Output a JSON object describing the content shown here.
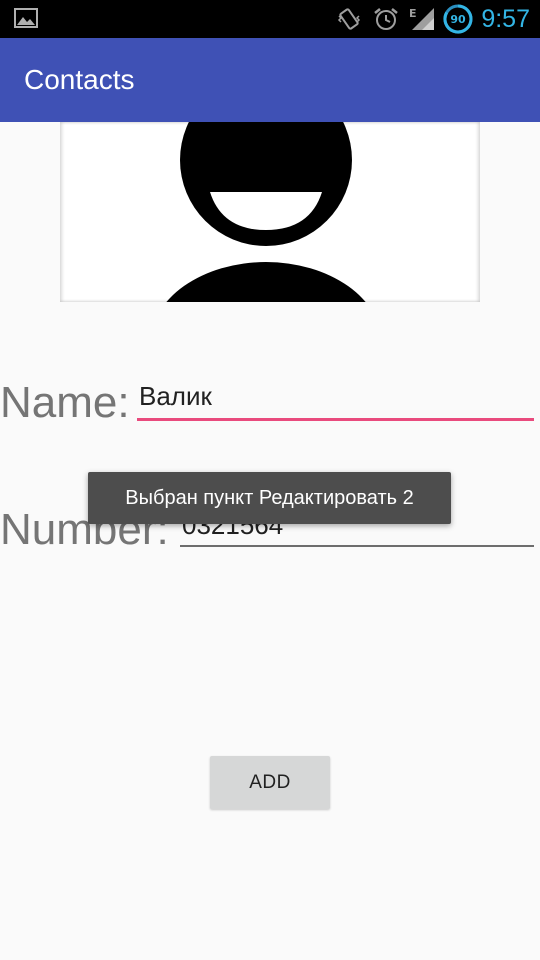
{
  "status_bar": {
    "time": "9:57",
    "battery_level": "90",
    "network_type": "E",
    "icons": [
      "gallery-icon",
      "vibrate-icon",
      "alarm-icon",
      "signal-icon",
      "battery-icon"
    ],
    "time_color": "#33b5e5"
  },
  "app_bar": {
    "title": "Contacts",
    "color": "#3f51b5"
  },
  "contact_photo": {
    "icon": "person-avatar-icon"
  },
  "form": {
    "name_label": "Name:",
    "name_value": "Валик",
    "number_label": "Number:",
    "number_value": "0321564",
    "accent_color": "#e91e63"
  },
  "toast": {
    "message": "Выбран пункт Редактировать 2"
  },
  "add_button": {
    "label": "ADD"
  }
}
